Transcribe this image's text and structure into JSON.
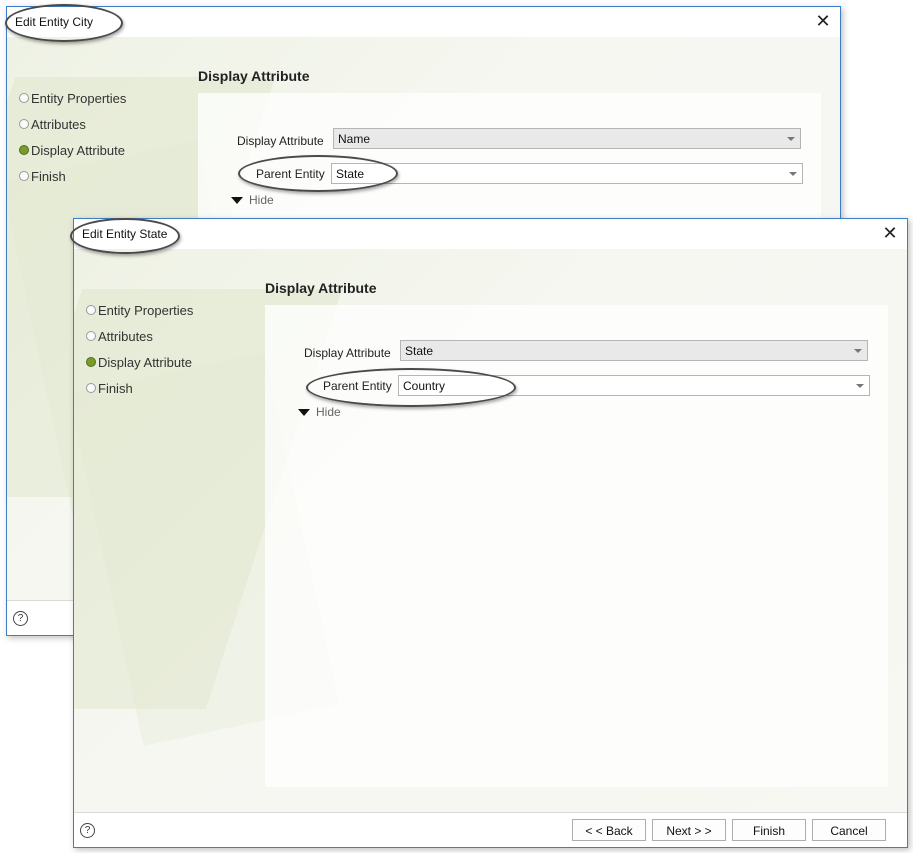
{
  "back_dialog": {
    "title": "Edit Entity City",
    "close_icon": "close-icon",
    "steps": [
      {
        "label": "Entity Properties",
        "active": false
      },
      {
        "label": "Attributes",
        "active": false
      },
      {
        "label": "Display Attribute",
        "active": true
      },
      {
        "label": "Finish",
        "active": false
      }
    ],
    "section_title": "Display Attribute",
    "display_attribute_label": "Display Attribute",
    "display_attribute_value": "Name",
    "parent_entity_label": "Parent Entity",
    "parent_entity_value": "State",
    "hide_label": "Hide",
    "help_symbol": "?"
  },
  "front_dialog": {
    "title": "Edit Entity State",
    "close_icon": "close-icon",
    "steps": [
      {
        "label": "Entity Properties",
        "active": false
      },
      {
        "label": "Attributes",
        "active": false
      },
      {
        "label": "Display Attribute",
        "active": true
      },
      {
        "label": "Finish",
        "active": false
      }
    ],
    "section_title": "Display Attribute",
    "display_attribute_label": "Display Attribute",
    "display_attribute_value": "State",
    "parent_entity_label": "Parent Entity",
    "parent_entity_value": "Country",
    "hide_label": "Hide",
    "help_symbol": "?",
    "buttons": {
      "back": "< < Back",
      "next": "Next > >",
      "finish": "Finish",
      "cancel": "Cancel"
    }
  },
  "colors": {
    "accent_border": "#3c7fc6",
    "active_step": "#7a9a2a"
  }
}
